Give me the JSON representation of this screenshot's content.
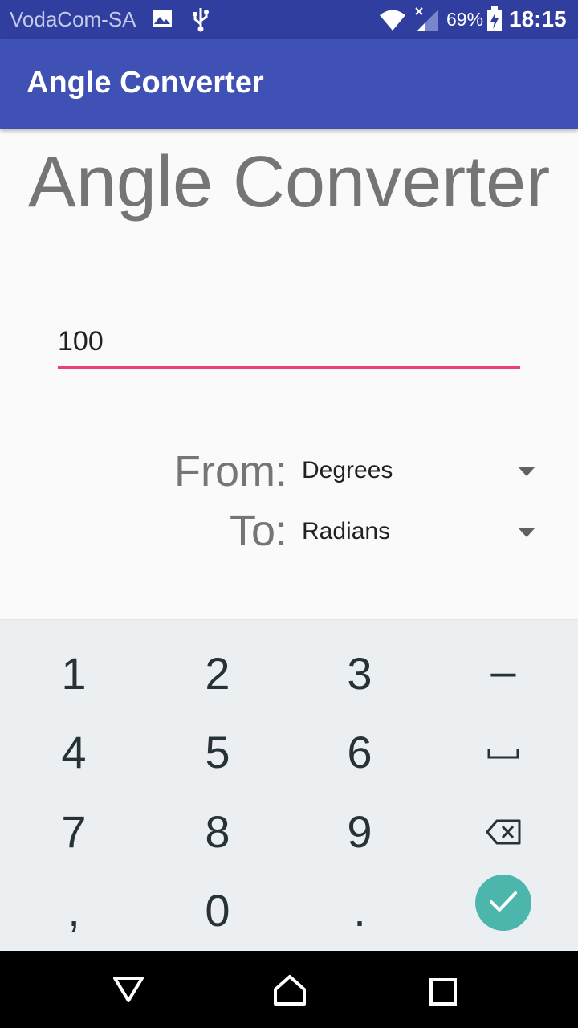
{
  "status_bar": {
    "carrier": "VodaCom-SA",
    "battery_percent": "69%",
    "time": "18:15"
  },
  "app_bar": {
    "title": "Angle Converter"
  },
  "main": {
    "heading": "Angle Converter",
    "input_value": "100",
    "from_label": "From:",
    "from_unit": "Degrees",
    "to_label": "To:",
    "to_unit": "Radians"
  },
  "keyboard": {
    "keys": [
      "1",
      "2",
      "3",
      "–",
      "4",
      "5",
      "6",
      "7",
      "8",
      "9",
      ",",
      "0",
      "."
    ]
  },
  "colors": {
    "status_bar": "#303f9f",
    "app_bar": "#3f51b5",
    "input_underline": "#ec407a",
    "done_button": "#4db6ac"
  }
}
